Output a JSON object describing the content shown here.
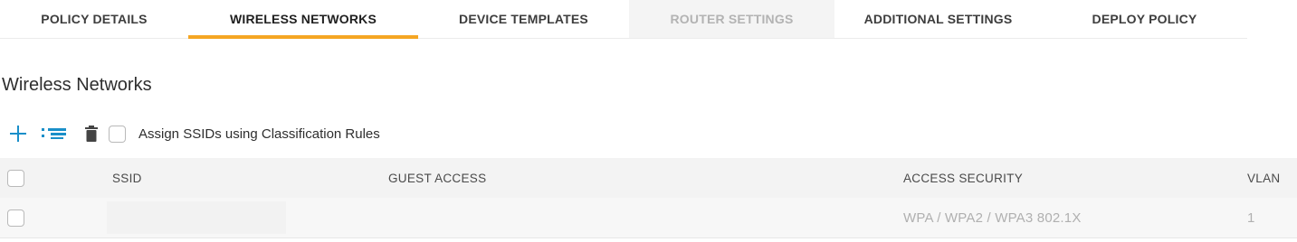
{
  "tabs": [
    {
      "label": "POLICY DETAILS",
      "state": "normal"
    },
    {
      "label": "WIRELESS NETWORKS",
      "state": "active"
    },
    {
      "label": "DEVICE TEMPLATES",
      "state": "normal"
    },
    {
      "label": "ROUTER SETTINGS",
      "state": "disabled"
    },
    {
      "label": "ADDITIONAL SETTINGS",
      "state": "normal"
    },
    {
      "label": "DEPLOY POLICY",
      "state": "normal"
    }
  ],
  "section": {
    "title": "Wireless Networks"
  },
  "toolbar": {
    "add_icon": "plus-icon",
    "reorder_icon": "list-icon",
    "delete_icon": "trash-icon",
    "assign_label": "Assign SSIDs using Classification Rules",
    "assign_checked": false
  },
  "table": {
    "columns": [
      "SSID",
      "GUEST ACCESS",
      "ACCESS SECURITY",
      "VLAN"
    ],
    "rows": [
      {
        "ssid": "",
        "guest_access": "",
        "access_security": "WPA / WPA2 / WPA3 802.1X",
        "vlan": "1"
      }
    ]
  },
  "colors": {
    "accent": "#f5a623",
    "add_icon": "#1a8fc9",
    "header_bg": "#f3f3f3",
    "row_bg": "#f7f7f7"
  }
}
